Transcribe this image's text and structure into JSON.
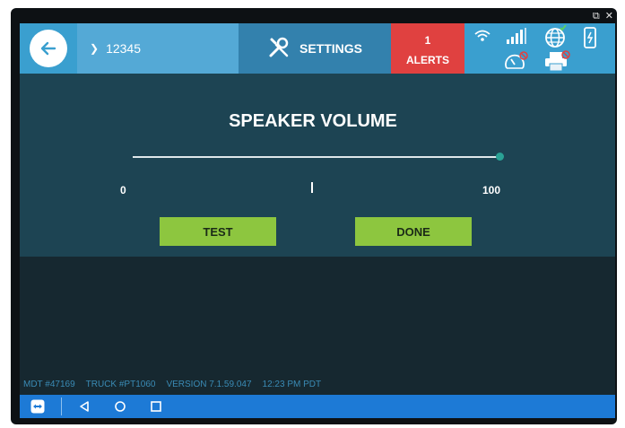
{
  "window_controls": {
    "popout": "⧉",
    "close": "✕"
  },
  "header": {
    "back_icon": "←",
    "route_chevron": "❯",
    "route_number": "12345",
    "settings_label": "SETTINGS",
    "alerts_count": "1",
    "alerts_label": "ALERTS"
  },
  "status_icons": [
    "wifi-icon",
    "signal-icon",
    "globe-icon",
    "phone-battery-icon",
    "speedometer-icon",
    "printer-icon"
  ],
  "panel": {
    "title": "SPEAKER VOLUME",
    "slider_value": 100,
    "slider_min_label": "0",
    "slider_max_label": "100",
    "test_button": "TEST",
    "done_button": "DONE"
  },
  "footer": {
    "mdt": "MDT #47169",
    "truck": "TRUCK #PT1060",
    "version": "VERSION  7.1.59.047",
    "time": "12:23 PM PDT"
  },
  "colors": {
    "topbar": "#3a9fcf",
    "alerts": "#e04140",
    "button": "#8dc63f",
    "panel": "#1d4453",
    "navbar": "#1d7ad6"
  }
}
